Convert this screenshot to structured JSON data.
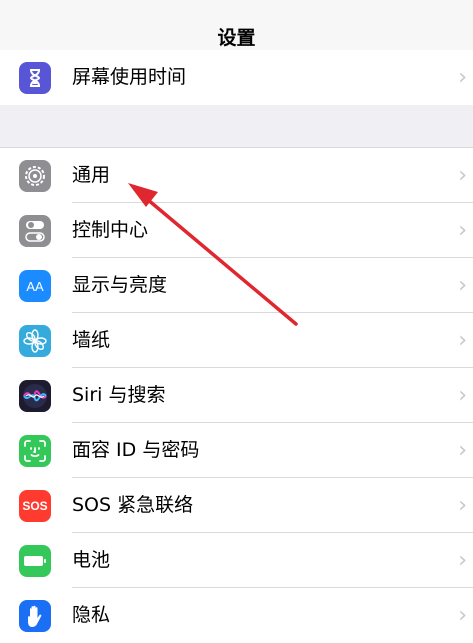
{
  "nav": {
    "title": "设置"
  },
  "group1": [
    {
      "label": "屏幕使用时间",
      "icon": "hourglass-icon",
      "color": "#5856d6"
    }
  ],
  "group2": [
    {
      "label": "通用",
      "icon": "gear-icon",
      "color": "#8e8e93"
    },
    {
      "label": "控制中心",
      "icon": "toggles-icon",
      "color": "#8e8e93"
    },
    {
      "label": "显示与亮度",
      "icon": "text-size-icon",
      "color": "#1a8cff",
      "glyph": "AA"
    },
    {
      "label": "墙纸",
      "icon": "flower-icon",
      "color": "#35aadc"
    },
    {
      "label": "Siri 与搜索",
      "icon": "siri-icon",
      "color": "#1c1c2e"
    },
    {
      "label": "面容 ID 与密码",
      "icon": "face-id-icon",
      "color": "#34c759"
    },
    {
      "label": "SOS 紧急联络",
      "icon": "sos-icon",
      "color": "#ff3b30",
      "glyph": "SOS"
    },
    {
      "label": "电池",
      "icon": "battery-icon",
      "color": "#34c759"
    },
    {
      "label": "隐私",
      "icon": "hand-icon",
      "color": "#1a6ff4"
    }
  ],
  "chevron": "›",
  "annotation": {
    "icon": "red-arrow-icon",
    "color": "#e0262f"
  }
}
